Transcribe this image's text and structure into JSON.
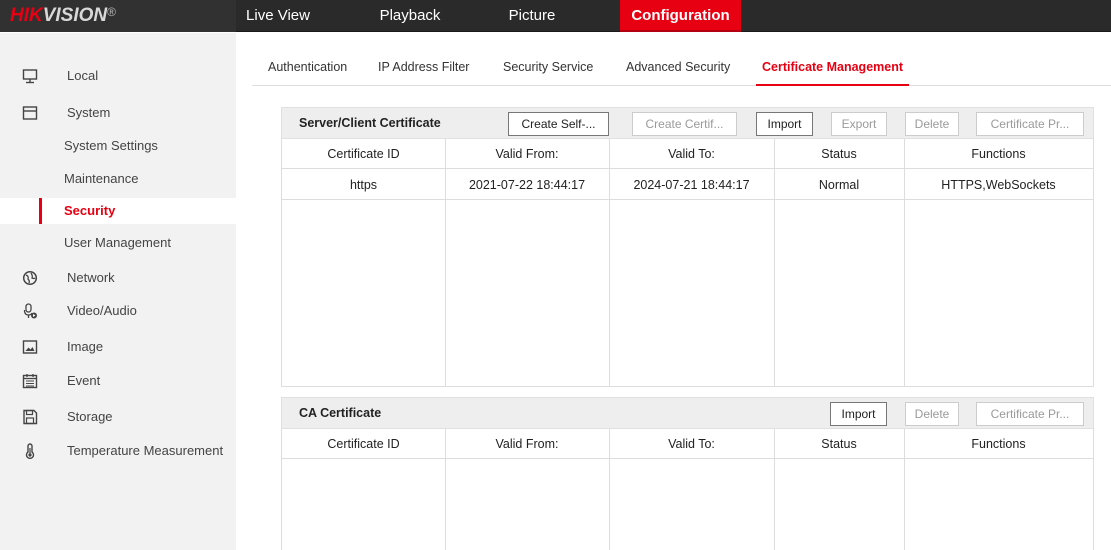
{
  "brand": {
    "logo_hik": "HIK",
    "logo_vision": "VISION",
    "logo_reg": "®"
  },
  "nav": [
    {
      "label": "Live View"
    },
    {
      "label": "Playback"
    },
    {
      "label": "Picture"
    },
    {
      "label": "Configuration"
    }
  ],
  "sidebar": {
    "items": [
      {
        "label": "Local",
        "icon": "monitor-icon"
      },
      {
        "label": "System",
        "icon": "system-icon"
      },
      {
        "label": "System Settings"
      },
      {
        "label": "Maintenance"
      },
      {
        "label": "Security"
      },
      {
        "label": "User Management"
      },
      {
        "label": "Network",
        "icon": "globe-icon"
      },
      {
        "label": "Video/Audio",
        "icon": "microphone-icon"
      },
      {
        "label": "Image",
        "icon": "image-icon"
      },
      {
        "label": "Event",
        "icon": "calendar-icon"
      },
      {
        "label": "Storage",
        "icon": "save-icon"
      },
      {
        "label": "Temperature Measurement",
        "icon": "thermometer-icon"
      }
    ],
    "active": "Security"
  },
  "tabs": [
    {
      "label": "Authentication"
    },
    {
      "label": "IP Address Filter"
    },
    {
      "label": "Security Service"
    },
    {
      "label": "Advanced Security"
    },
    {
      "label": "Certificate Management"
    }
  ],
  "server_panel": {
    "title": "Server/Client Certificate",
    "buttons": {
      "create_self": "Create Self-...",
      "create_cert": "Create Certif...",
      "import": "Import",
      "export": "Export",
      "delete": "Delete",
      "cert_props": "Certificate Pr..."
    },
    "columns": [
      "Certificate ID",
      "Valid From:",
      "Valid To:",
      "Status",
      "Functions"
    ],
    "rows": [
      {
        "id": "https",
        "from": "2021-07-22 18:44:17",
        "to": "2024-07-21 18:44:17",
        "status": "Normal",
        "functions": "HTTPS,WebSockets"
      }
    ]
  },
  "ca_panel": {
    "title": "CA Certificate",
    "buttons": {
      "import": "Import",
      "delete": "Delete",
      "cert_props": "Certificate Pr..."
    },
    "columns": [
      "Certificate ID",
      "Valid From:",
      "Valid To:",
      "Status",
      "Functions"
    ]
  },
  "colors": {
    "accent": "#e60012",
    "topbar": "#2a2a2a",
    "sidebar": "#f2f2f2"
  }
}
